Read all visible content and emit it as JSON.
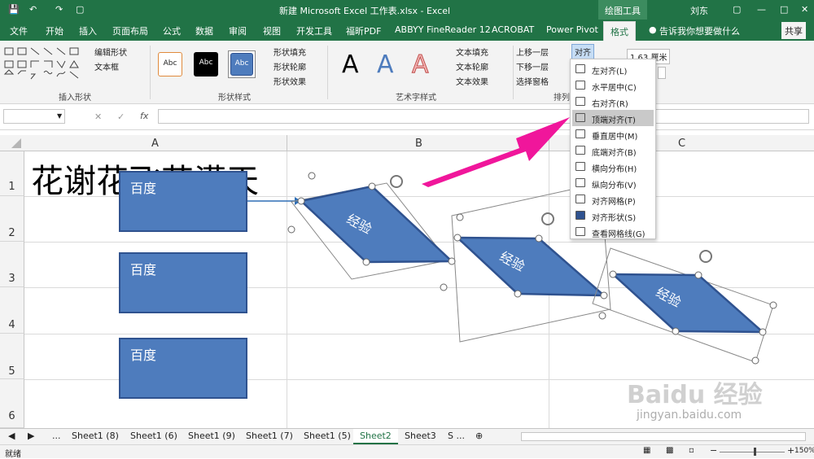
{
  "window": {
    "title": "新建 Microsoft Excel 工作表.xlsx  -  Excel",
    "context_tool": "绘图工具",
    "user": "刘东",
    "share": "共享"
  },
  "tabs": [
    "文件",
    "开始",
    "插入",
    "页面布局",
    "公式",
    "数据",
    "审阅",
    "视图",
    "开发工具",
    "福昕PDF",
    "ABBYY FineReader 12",
    "ACROBAT",
    "Power Pivot",
    "格式"
  ],
  "tell_me": "告诉我你想要做什么",
  "ribbon": {
    "groups": {
      "insert_shapes": "插入形状",
      "shape_styles": "形状样式",
      "wordart_styles": "艺术字样式",
      "arrange": "排列"
    },
    "edit_shape": "编辑形状",
    "textbox": "文本框",
    "shape_fill": "形状填充",
    "shape_outline": "形状轮廓",
    "shape_effects": "形状效果",
    "text_fill": "文本填充",
    "text_outline": "文本轮廓",
    "text_effects": "文本效果",
    "bring_forward": "上移一层",
    "send_backward": "下移一层",
    "selection_pane": "选择窗格",
    "align": "对齐",
    "height_value": "1.63 厘米",
    "style_abc": "Abc",
    "wordart_a": "A"
  },
  "align_menu": {
    "items": [
      "左对齐(L)",
      "水平居中(C)",
      "右对齐(R)",
      "顶端对齐(T)",
      "垂直居中(M)",
      "底端对齐(B)",
      "横向分布(H)",
      "纵向分布(V)",
      "对齐网格(P)",
      "对齐形状(S)",
      "查看网格线(G)"
    ],
    "highlighted_index": 3
  },
  "formula": {
    "fx": "fx"
  },
  "columns": [
    "A",
    "B",
    "C"
  ],
  "rows": [
    "1",
    "2",
    "3",
    "4",
    "5",
    "6"
  ],
  "cell_text": "花谢花飞花满天",
  "shapes": {
    "rect_labels": [
      "百度",
      "百度",
      "百度"
    ],
    "parallelogram_labels": [
      "经验",
      "经验",
      "经验"
    ]
  },
  "sheets": [
    "Sheet1 (8)",
    "Sheet1 (6)",
    "Sheet1 (9)",
    "Sheet1 (7)",
    "Sheet1 (5)",
    "Sheet2",
    "Sheet3",
    "S ..."
  ],
  "active_sheet": "Sheet2",
  "status": {
    "ready": "就绪",
    "zoom": "150%"
  },
  "watermark": {
    "brand": "Baidu 经验",
    "url": "jingyan.baidu.com"
  },
  "colors": {
    "excel_green": "#217346",
    "shape_fill": "#4e7cbd",
    "shape_border": "#2f528f",
    "arrow": "#f0169b"
  }
}
